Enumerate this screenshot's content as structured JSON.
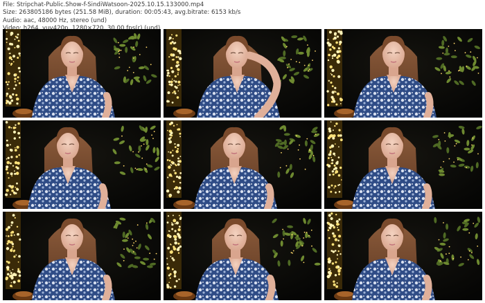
{
  "info": {
    "file": "File: Stripchat-Public.Show-f-SindiWatsoon-2025.10.15.133000.mp4",
    "size": "Size: 263805186 bytes (251.58 MiB), duration: 00:05:43, avg.bitrate: 6153 kb/s",
    "audio": "Audio: aac, 48000 Hz, stereo (und)",
    "video": "Video: h264, yuv420p, 1280×720, 30.00 fps(r) (und)"
  },
  "thumbnails": [
    {
      "id": 1,
      "pose": "hands-down"
    },
    {
      "id": 2,
      "pose": "hand-on-head"
    },
    {
      "id": 3,
      "pose": "hands-down"
    },
    {
      "id": 4,
      "pose": "hands-down"
    },
    {
      "id": 5,
      "pose": "hands-down"
    },
    {
      "id": 6,
      "pose": "hands-down"
    },
    {
      "id": 7,
      "pose": "hands-down"
    },
    {
      "id": 8,
      "pose": "hands-down"
    },
    {
      "id": 9,
      "pose": "hands-down"
    }
  ]
}
